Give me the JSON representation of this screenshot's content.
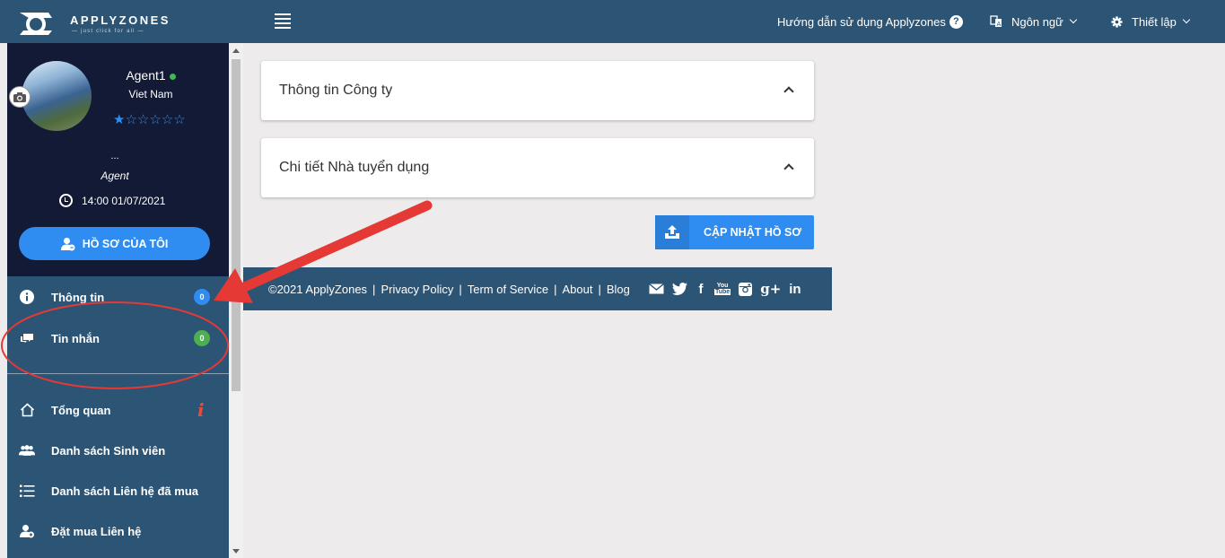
{
  "header": {
    "logo_text": "APPLYZONES",
    "logo_tagline": "— just click for all —",
    "guide_label": "Hướng dẫn sử dụng Applyzones",
    "help_symbol": "?",
    "language_label": "Ngôn ngữ",
    "settings_label": "Thiết lập"
  },
  "profile": {
    "name": "Agent1",
    "country": "Viet Nam",
    "stars": "★☆☆☆☆☆",
    "rating_fraction": 0.08,
    "dots": "...",
    "role": "Agent",
    "datetime": "14:00 01/07/2021",
    "profile_button": "HỒ SƠ CỦA TÔI"
  },
  "sidebar": {
    "items": [
      {
        "label": "Thông tin",
        "badge": "0",
        "badge_color": "#2f8cf0"
      },
      {
        "label": "Tin nhắn",
        "badge": "0",
        "badge_color": "#4caf50"
      },
      {
        "label": "Tổng quan",
        "info": "i"
      },
      {
        "label": "Danh sách Sinh viên"
      },
      {
        "label": "Danh sách Liên hệ đã mua"
      },
      {
        "label": "Đặt mua Liên hệ"
      }
    ]
  },
  "main": {
    "cards": [
      {
        "title": "Thông tin Công ty"
      },
      {
        "title": "Chi tiết Nhà tuyển dụng"
      }
    ],
    "update_button": "CẬP NHẬT HỒ SƠ"
  },
  "footer": {
    "copyright": "©2021 ApplyZones",
    "links": [
      "Privacy Policy",
      "Term of Service",
      "About",
      "Blog"
    ],
    "separator": "|",
    "social": {
      "facebook": "f",
      "youtube_top": "You",
      "youtube_bottom": "Tube",
      "googleplus": "g+",
      "linkedin": "in"
    }
  },
  "colors": {
    "header_bg": "#2c5475",
    "profile_bg": "#121a35",
    "accent": "#2f8cf0",
    "annotation": "#e53935"
  }
}
